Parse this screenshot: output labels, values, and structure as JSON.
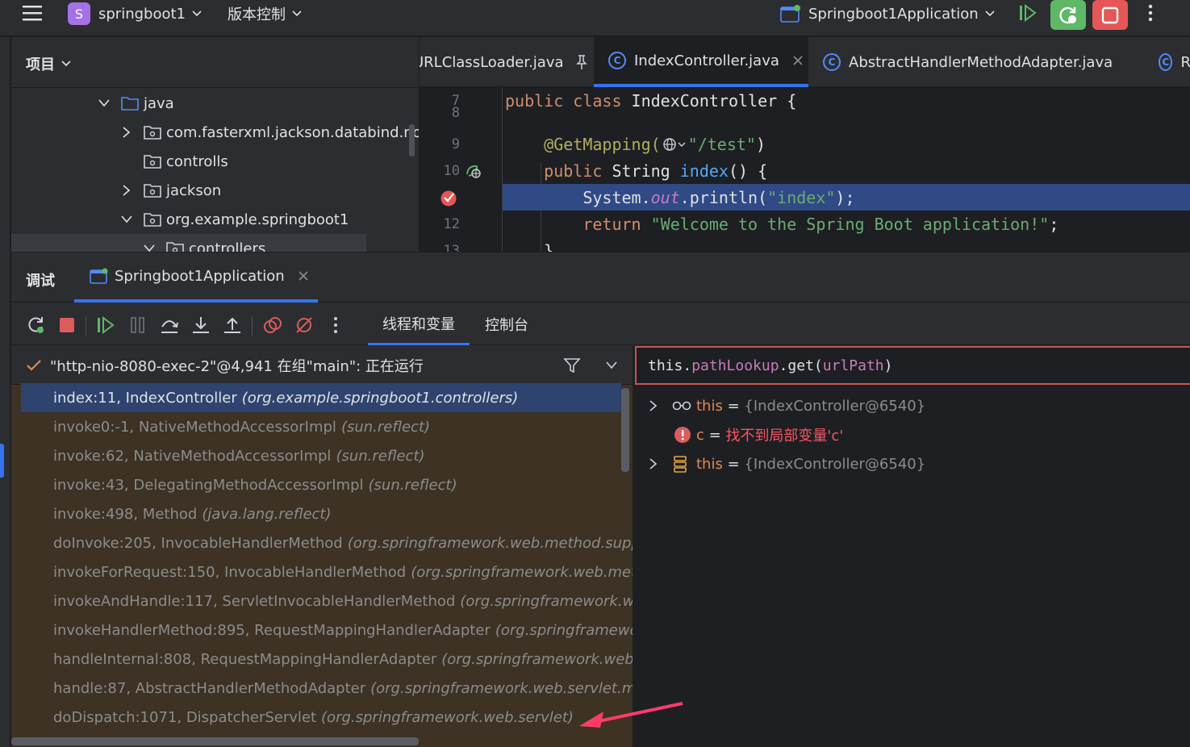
{
  "topbar": {
    "project_badge": "S",
    "project_name": "springboot1",
    "vcs_menu": "版本控制",
    "run_config": "Springboot1Application"
  },
  "project_panel": {
    "title": "项目",
    "tree": [
      {
        "label": "java",
        "expanded": true
      },
      {
        "label": "com.fasterxml.jackson.databind.node",
        "expanded": false
      },
      {
        "label": "controlls",
        "expanded": null
      },
      {
        "label": "jackson",
        "expanded": false
      },
      {
        "label": "org.example.springboot1",
        "expanded": true
      },
      {
        "label": "controllers",
        "expanded": true
      }
    ]
  },
  "editor": {
    "tabs": [
      {
        "label": "URLClassLoader.java"
      },
      {
        "label": "IndexController.java"
      },
      {
        "label": "AbstractHandlerMethodAdapter.java"
      },
      {
        "label": "R"
      }
    ],
    "lines": [
      {
        "num": "7",
        "parts": [
          {
            "t": "public class ",
            "c": "kw"
          },
          {
            "t": "IndexController {",
            "c": ""
          }
        ]
      },
      {
        "num": "8",
        "parts": []
      },
      {
        "num": "9",
        "parts": [
          {
            "t": "    @GetMapping(",
            "c": "ann"
          },
          {
            "t": "\"/test\"",
            "c": "str"
          },
          {
            "t": ")",
            "c": ""
          }
        ]
      },
      {
        "num": "10",
        "parts": [
          {
            "t": "    public ",
            "c": "kw"
          },
          {
            "t": "String ",
            "c": ""
          },
          {
            "t": "index",
            "c": "fn"
          },
          {
            "t": "() {",
            "c": ""
          }
        ]
      },
      {
        "num": "",
        "parts": [
          {
            "t": "        System.",
            "c": ""
          },
          {
            "t": "out",
            "c": "fld"
          },
          {
            "t": ".println(",
            "c": ""
          },
          {
            "t": "\"index\"",
            "c": "str"
          },
          {
            "t": ");",
            "c": ""
          }
        ]
      },
      {
        "num": "12",
        "parts": [
          {
            "t": "        return ",
            "c": "kw"
          },
          {
            "t": "\"Welcome to the Spring Boot application!\"",
            "c": "str"
          },
          {
            "t": ";",
            "c": ""
          }
        ]
      },
      {
        "num": "13",
        "parts": [
          {
            "t": "    }",
            "c": ""
          }
        ]
      }
    ]
  },
  "debug": {
    "panel_title": "调试",
    "session_tab": "Springboot1Application",
    "tabs": [
      "线程和变量",
      "控制台"
    ],
    "thread": "\"http-nio-8080-exec-2\"@4,941 在组\"main\": 正在运行",
    "frames": [
      {
        "method": "index:11, IndexController",
        "pkg": "(org.example.springboot1.controllers)"
      },
      {
        "method": "invoke0:-1, NativeMethodAccessorImpl",
        "pkg": "(sun.reflect)"
      },
      {
        "method": "invoke:62, NativeMethodAccessorImpl",
        "pkg": "(sun.reflect)"
      },
      {
        "method": "invoke:43, DelegatingMethodAccessorImpl",
        "pkg": "(sun.reflect)"
      },
      {
        "method": "invoke:498, Method",
        "pkg": "(java.lang.reflect)"
      },
      {
        "method": "doInvoke:205, InvocableHandlerMethod",
        "pkg": "(org.springframework.web.method.suppor"
      },
      {
        "method": "invokeForRequest:150, InvocableHandlerMethod",
        "pkg": "(org.springframework.web.metho"
      },
      {
        "method": "invokeAndHandle:117, ServletInvocableHandlerMethod",
        "pkg": "(org.springframework.web."
      },
      {
        "method": "invokeHandlerMethod:895, RequestMappingHandlerAdapter",
        "pkg": "(org.springframewor"
      },
      {
        "method": "handleInternal:808, RequestMappingHandlerAdapter",
        "pkg": "(org.springframework.web.se"
      },
      {
        "method": "handle:87, AbstractHandlerMethodAdapter",
        "pkg": "(org.springframework.web.servlet.mvc."
      },
      {
        "method": "doDispatch:1071, DispatcherServlet",
        "pkg": "(org.springframework.web.servlet)"
      }
    ],
    "expression": {
      "p1": "this",
      "p2": ".",
      "p3": "pathLookup",
      "p4": ".get(",
      "p5": "urlPath",
      "p6": ")"
    },
    "variables": [
      {
        "name": "this",
        "eq": " = ",
        "value": "{IndexController@6540}"
      },
      {
        "name": "c",
        "eq": " = ",
        "value": "找不到局部变量'c'"
      },
      {
        "name": "this",
        "eq": " = ",
        "value": "{IndexController@6540}"
      }
    ]
  }
}
